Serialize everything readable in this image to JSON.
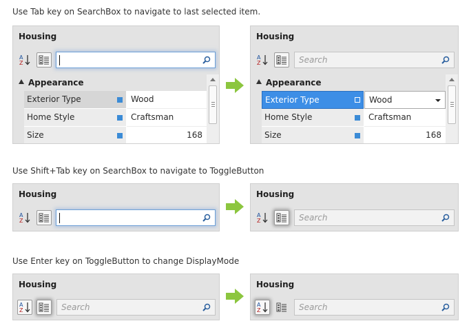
{
  "captions": [
    "Use Tab key on SearchBox to navigate to last selected item.",
    "Use Shift+Tab key on SearchBox to navigate to ToggleButton",
    "Use Enter key on ToggleButton to change DisplayMode"
  ],
  "panel_title": "Housing",
  "search_placeholder": "Search",
  "category": "Appearance",
  "properties": [
    {
      "name": "Exterior Type",
      "value": "Wood"
    },
    {
      "name": "Home Style",
      "value": "Craftsman"
    },
    {
      "name": "Size",
      "value": "168"
    }
  ],
  "icons": {
    "sort": "sort-alphabetical-icon",
    "category": "categorized-view-icon",
    "search": "magnifier-icon",
    "arrow": "right-arrow-icon",
    "dropdown": "dropdown-arrow-icon"
  },
  "colors": {
    "accent": "#3d8ee6",
    "marker": "#3b8bd6",
    "arrow": "#8cc63f",
    "panel": "#e3e3e3"
  }
}
